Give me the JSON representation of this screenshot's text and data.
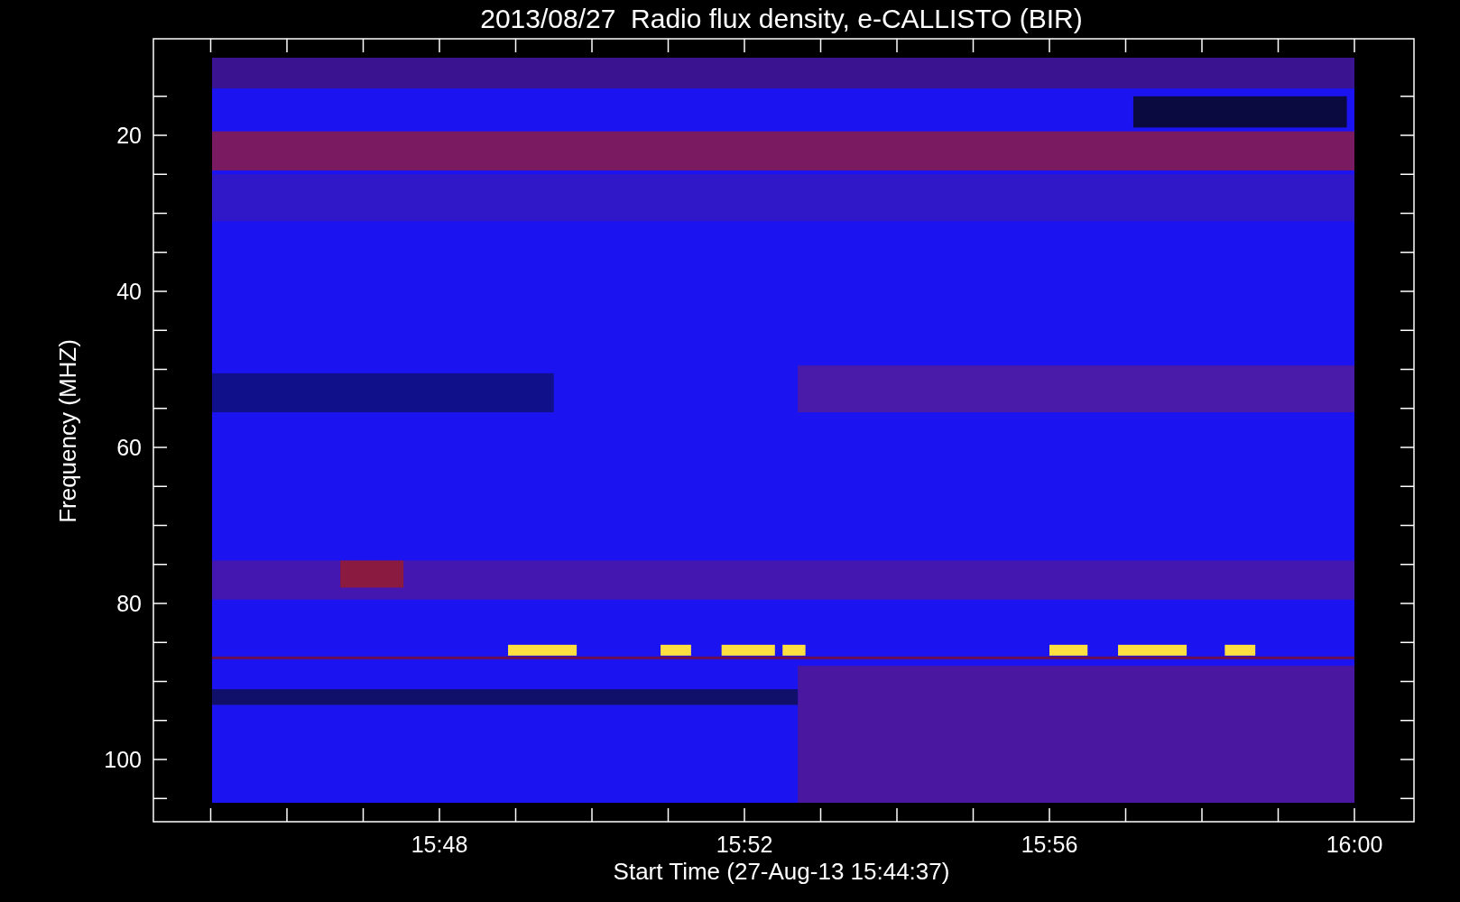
{
  "title": "2013/08/27  Radio flux density, e-CALLISTO (BIR)",
  "y_axis": {
    "label": "Frequency (MHZ)",
    "ticks": [
      "20",
      "40",
      "60",
      "80",
      "100"
    ]
  },
  "x_axis": {
    "label": "Start Time (27-Aug-13 15:44:37)",
    "ticks": [
      "15:48",
      "15:52",
      "15:56",
      "16:00"
    ]
  }
}
